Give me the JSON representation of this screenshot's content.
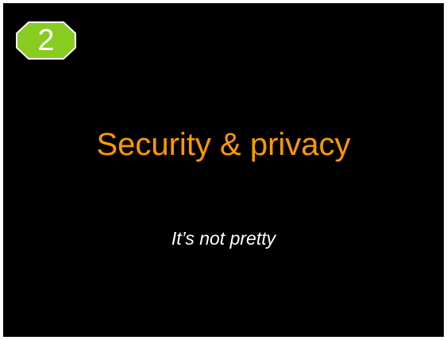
{
  "slide": {
    "badge_number": "2",
    "badge_color": "#88cc22",
    "title": "Security & privacy",
    "title_color": "#ff9900",
    "subtitle": "It’s not pretty",
    "subtitle_color": "#ffffff",
    "background_color": "#000000",
    "badge_icon": "octagon-number-badge-icon"
  }
}
